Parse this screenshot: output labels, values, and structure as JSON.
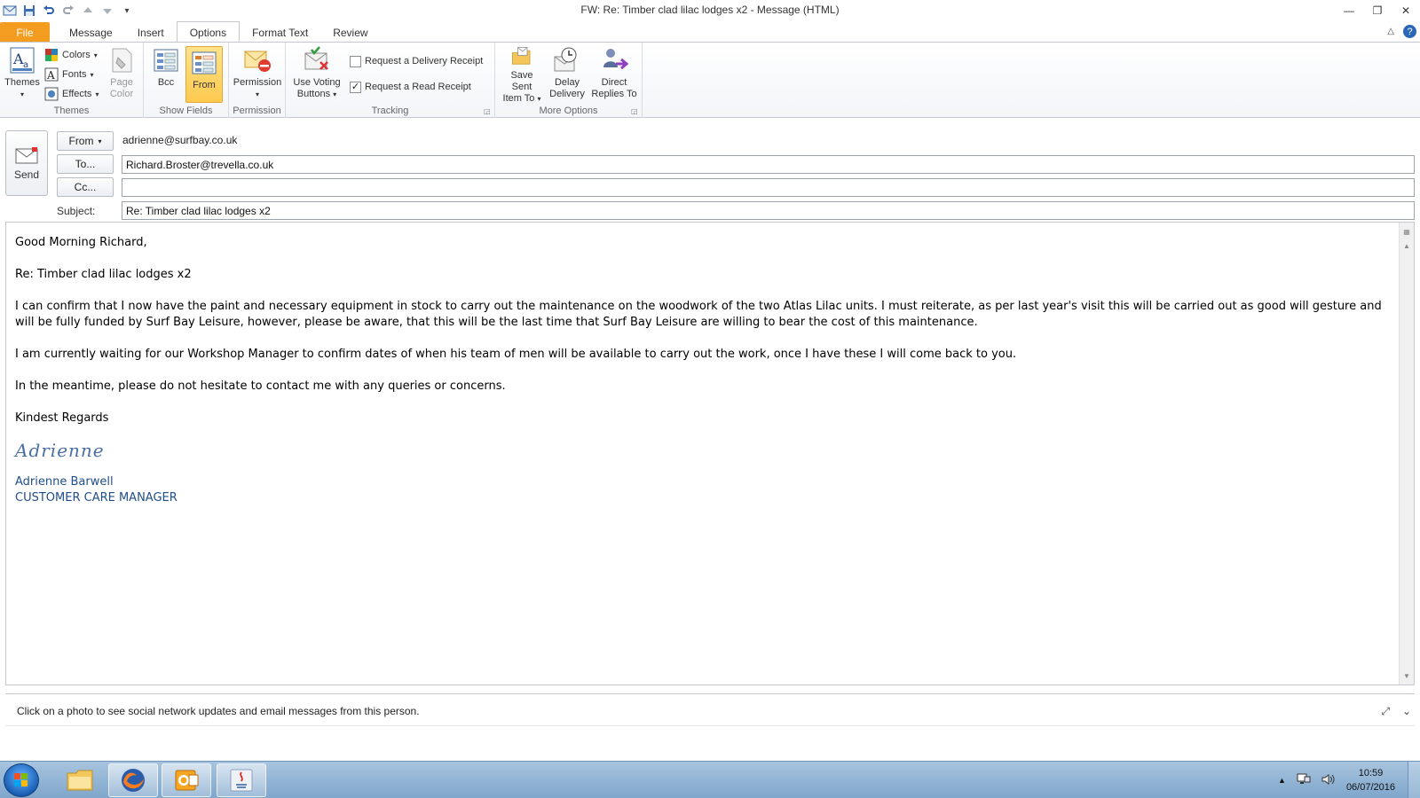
{
  "window": {
    "title": "FW: Re: Timber clad lilac lodges x2  -  Message (HTML)"
  },
  "tabs": [
    {
      "label": "File"
    },
    {
      "label": "Message"
    },
    {
      "label": "Insert"
    },
    {
      "label": "Options"
    },
    {
      "label": "Format Text"
    },
    {
      "label": "Review"
    }
  ],
  "ribbon": {
    "themes_group": {
      "label": "Themes",
      "themes_btn": "Themes",
      "colors_btn": "Colors",
      "fonts_btn": "Fonts",
      "effects_btn": "Effects",
      "page_color_btn_line1": "Page",
      "page_color_btn_line2": "Color"
    },
    "show_fields_group": {
      "label": "Show Fields",
      "bcc_btn": "Bcc",
      "from_btn": "From"
    },
    "permission_group": {
      "label": "Permission",
      "permission_btn": "Permission"
    },
    "tracking_group": {
      "label": "Tracking",
      "voting_btn_line1": "Use Voting",
      "voting_btn_line2": "Buttons",
      "delivery_receipt": "Request a Delivery Receipt",
      "read_receipt": "Request a Read Receipt"
    },
    "more_options_group": {
      "label": "More Options",
      "save_sent_line1": "Save Sent",
      "save_sent_line2": "Item To",
      "delay_line1": "Delay",
      "delay_line2": "Delivery",
      "direct_line1": "Direct",
      "direct_line2": "Replies To"
    }
  },
  "header": {
    "send_label": "Send",
    "from_btn": "From",
    "from_value": "adrienne@surfbay.co.uk",
    "to_btn": "To...",
    "to_value": "Richard.Broster@trevella.co.uk",
    "cc_btn": "Cc...",
    "cc_value": "",
    "subject_label": "Subject:",
    "subject_value": "Re: Timber clad lilac lodges x2"
  },
  "message": {
    "greeting": "Good Morning Richard,",
    "re_line": "Re: Timber clad lilac lodges x2",
    "para1": "I can confirm that I now have the paint and necessary equipment in stock to carry out the maintenance on the woodwork of the two Atlas Lilac units.  I must reiterate, as per last year's visit this will be carried out as good will  gesture and will be fully funded by Surf Bay Leisure, however, please be aware, that  this will be the last time that Surf Bay Leisure are willing to bear the cost of this maintenance.",
    "para2": "I am currently waiting for our Workshop Manager to confirm dates of when his team of men will be available to carry out the work, once I have these I will come back to you.",
    "para3": "In the meantime, please do not hesitate to contact me with any queries or concerns.",
    "closing": "Kindest Regards",
    "signature_script": "Adrienne",
    "sig_name": "Adrienne Barwell",
    "sig_title": "CUSTOMER CARE MANAGER"
  },
  "people_pane": {
    "text": "Click on a photo to see social network updates and email messages from this person."
  },
  "taskbar": {
    "time": "10:59",
    "date": "06/07/2016"
  },
  "colors": {
    "file_tab": "#f39c20",
    "pressed_btn": "#fdc94f",
    "signature": "#1f4e8c"
  }
}
